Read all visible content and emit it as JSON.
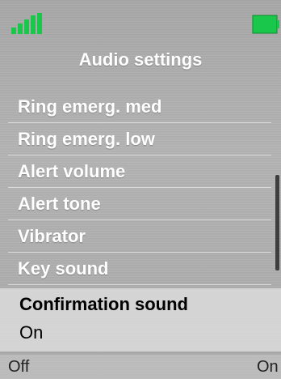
{
  "status": {
    "signal_icon": "signal-strength-icon",
    "battery_icon": "battery-icon",
    "accent_color": "#19c84a"
  },
  "screen": {
    "title": "Audio settings"
  },
  "menu": {
    "items": [
      {
        "label": "Ring emerg. med"
      },
      {
        "label": "Ring emerg. low"
      },
      {
        "label": "Alert volume"
      },
      {
        "label": "Alert tone"
      },
      {
        "label": "Vibrator"
      },
      {
        "label": "Key sound"
      }
    ],
    "selected": {
      "label": "Confirmation sound",
      "value": "On"
    }
  },
  "softkeys": {
    "left": "Off",
    "right": "On"
  }
}
